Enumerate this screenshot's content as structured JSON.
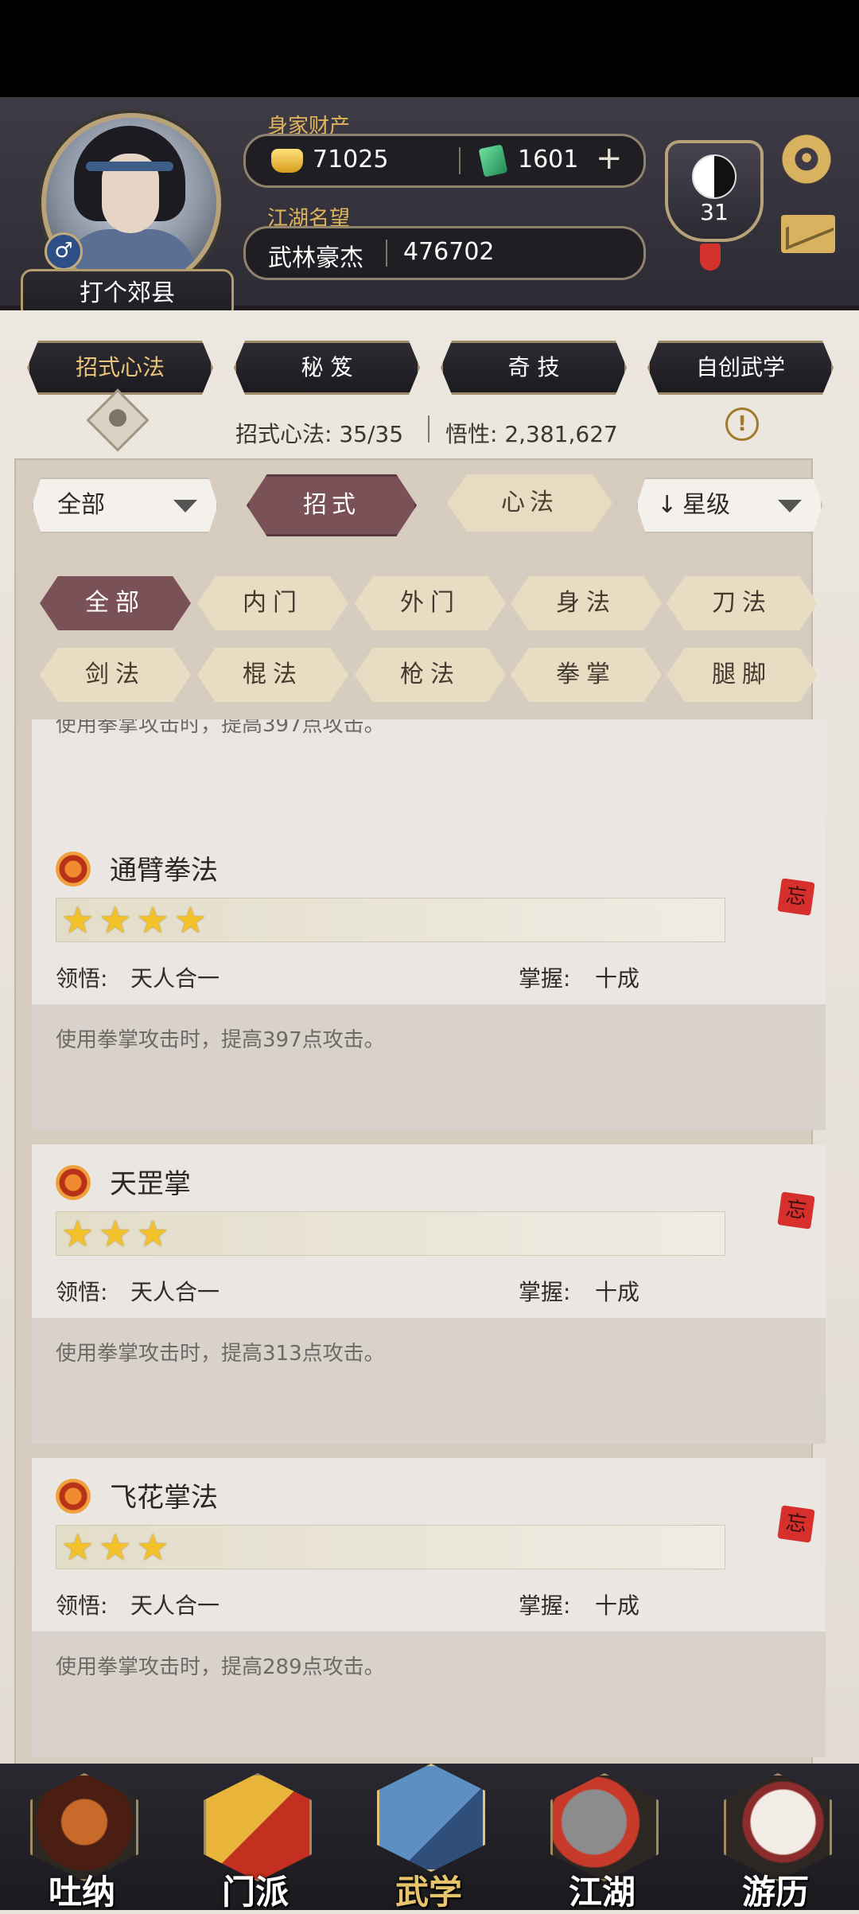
{
  "header": {
    "player_name": "打个郊县",
    "gender_symbol": "♂",
    "wealth_label": "身家财产",
    "gold_amount": "71025",
    "jade_amount": "1601",
    "plus_symbol": "+",
    "reputation_label": "江湖名望",
    "reputation_title": "武林豪杰",
    "reputation_value": "476702",
    "level": "31"
  },
  "main_tabs": [
    {
      "label": "招式心法",
      "active": true
    },
    {
      "label": "秘 笈",
      "active": false
    },
    {
      "label": "奇 技",
      "active": false
    },
    {
      "label": "自创武学",
      "active": false
    }
  ],
  "stats": {
    "skills_text": "招式心法: 35/35",
    "insight_text": "悟性: 2,381,627",
    "info_symbol": "!"
  },
  "controls": {
    "category_select": "全部",
    "type_moves": "招式",
    "type_mental": "心法",
    "sort_select": "星级",
    "sort_arrow": "↓"
  },
  "filters": [
    {
      "label": "全部",
      "active": true
    },
    {
      "label": "内门",
      "active": false
    },
    {
      "label": "外门",
      "active": false
    },
    {
      "label": "身法",
      "active": false
    },
    {
      "label": "刀法",
      "active": false
    },
    {
      "label": "剑法",
      "active": false
    },
    {
      "label": "棍法",
      "active": false
    },
    {
      "label": "枪法",
      "active": false
    },
    {
      "label": "拳掌",
      "active": false
    },
    {
      "label": "腿脚",
      "active": false
    }
  ],
  "cards": [
    {
      "name": "通臂拳法",
      "stars": "★★★★",
      "star_count": 4,
      "insight_label": "领悟:",
      "insight_value": "天人合一",
      "mastery_label": "掌握:",
      "mastery_value": "十成",
      "description": "使用拳掌攻击时，提高397点攻击。",
      "forget_tag": "忘"
    },
    {
      "name": "天罡掌",
      "stars": "★★★",
      "star_count": 3,
      "insight_label": "领悟:",
      "insight_value": "天人合一",
      "mastery_label": "掌握:",
      "mastery_value": "十成",
      "description": "使用拳掌攻击时，提高313点攻击。",
      "forget_tag": "忘"
    },
    {
      "name": "飞花掌法",
      "stars": "★★★",
      "star_count": 3,
      "insight_label": "领悟:",
      "insight_value": "天人合一",
      "mastery_label": "掌握:",
      "mastery_value": "十成",
      "description": "使用拳掌攻击时，提高289点攻击。",
      "forget_tag": "忘"
    }
  ],
  "partial_card_description": "使用拳掌攻击时，提高397点攻击。",
  "bottom_nav": [
    {
      "label": "吐纳",
      "icon": "monk-icon",
      "active": false
    },
    {
      "label": "门派",
      "icon": "sect-banner-icon",
      "active": false
    },
    {
      "label": "武学",
      "icon": "martial-book-icon",
      "active": true
    },
    {
      "label": "江湖",
      "icon": "straw-hat-icon",
      "active": false
    },
    {
      "label": "游历",
      "icon": "horse-icon",
      "active": false
    }
  ],
  "colors": {
    "accent_active": "#7b5158",
    "gold_text": "#e0b55b",
    "star": "#f3c22b",
    "forget_tag": "#d62f2c"
  }
}
